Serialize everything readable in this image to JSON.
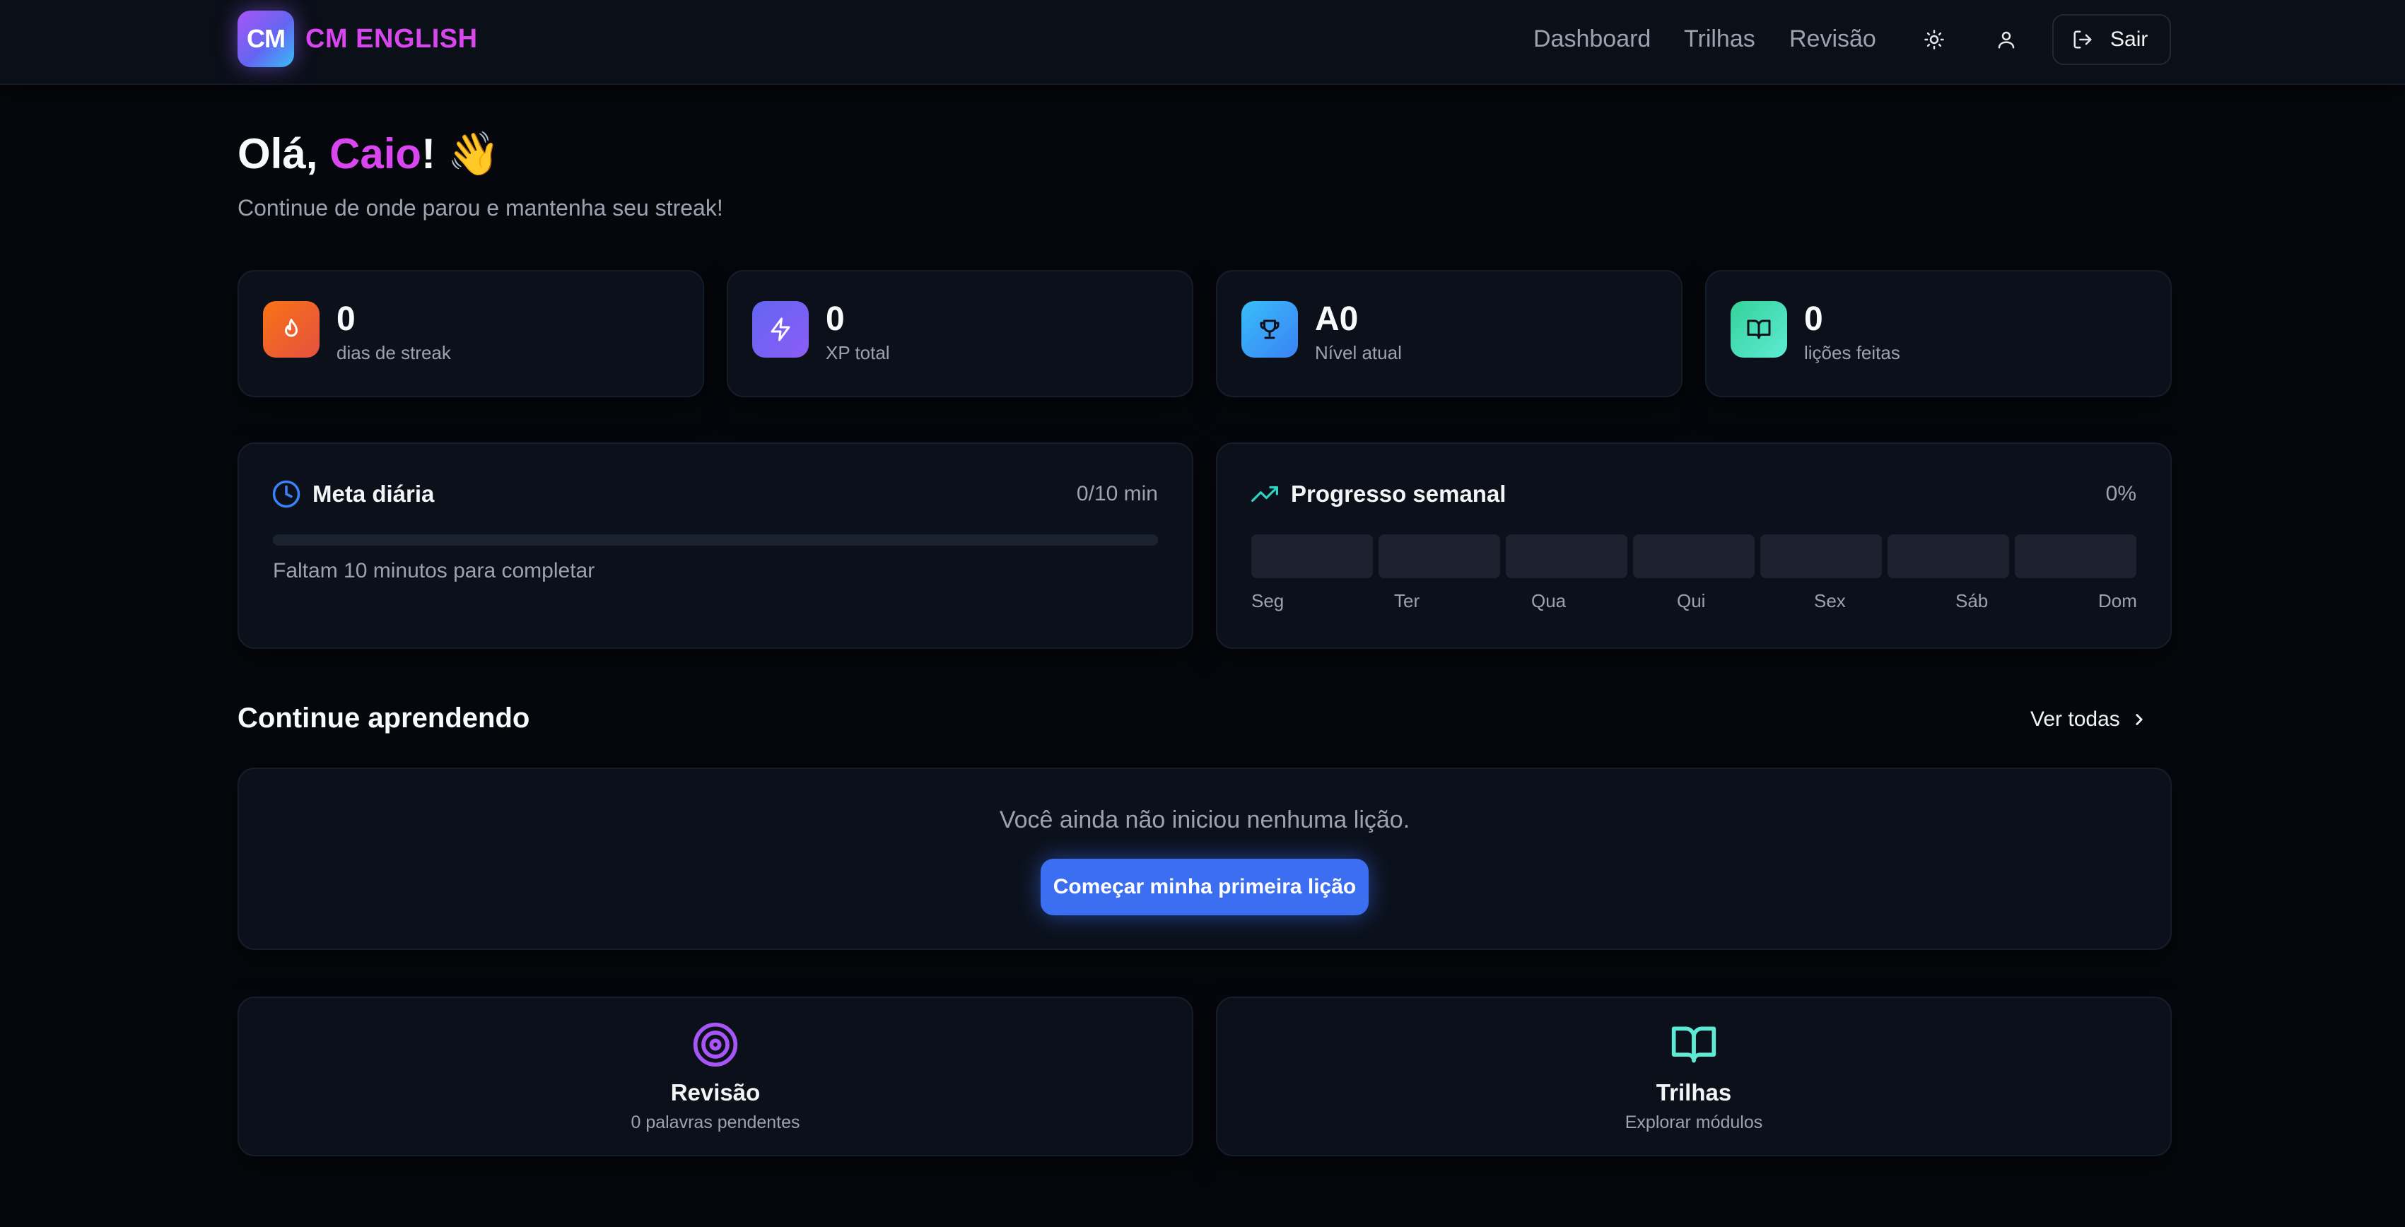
{
  "nav": {
    "logo_text": "CM",
    "brand": "CM ENGLISH",
    "links": [
      "Dashboard",
      "Trilhas",
      "Revisão"
    ],
    "theme_icon": "sun-icon",
    "profile_icon": "user-icon",
    "logout_label": "Sair",
    "logout_icon": "log-out-icon"
  },
  "greeting": {
    "prefix": "Olá, ",
    "name": "Caio",
    "suffix": "! 👋",
    "subtitle": "Continue de onde parou e mantenha seu streak!"
  },
  "stats": [
    {
      "value": "0",
      "label": "dias de streak",
      "icon": "flame-icon",
      "color": "#f97316"
    },
    {
      "value": "0",
      "label": "XP total",
      "icon": "zap-icon",
      "color": "#6366f1"
    },
    {
      "value": "A0",
      "label": "Nível atual",
      "icon": "trophy-icon",
      "color": "#38bdf8"
    },
    {
      "value": "0",
      "label": "lições feitas",
      "icon": "book-open-icon",
      "color": "#34d399"
    }
  ],
  "daily_goal": {
    "title": "Meta diária",
    "progress_text": "0/10 min",
    "progress_fraction": 0,
    "note": "Faltam 10 minutos para completar",
    "icon": "clock-icon"
  },
  "weekly_progress": {
    "title": "Progresso semanal",
    "percent_text": "0%",
    "icon": "trending-up-icon",
    "days": [
      "Seg",
      "Ter",
      "Qua",
      "Qui",
      "Sex",
      "Sáb",
      "Dom"
    ],
    "values": [
      0,
      0,
      0,
      0,
      0,
      0,
      0
    ]
  },
  "continue": {
    "title": "Continue aprendendo",
    "see_all": "Ver todas",
    "empty_text": "Você ainda não iniciou nenhuma lição.",
    "cta": "Começar minha primeira lição"
  },
  "actions": [
    {
      "title": "Revisão",
      "subtitle": "0 palavras pendentes",
      "icon": "target-icon",
      "color": "#a855f7"
    },
    {
      "title": "Trilhas",
      "subtitle": "Explorar módulos",
      "icon": "book-open-icon",
      "color": "#5eead4"
    }
  ],
  "colors": {
    "accent": "#d946ef",
    "primary_button": "#3b6ef0",
    "background": "#05070c",
    "card": "#0b101a"
  }
}
